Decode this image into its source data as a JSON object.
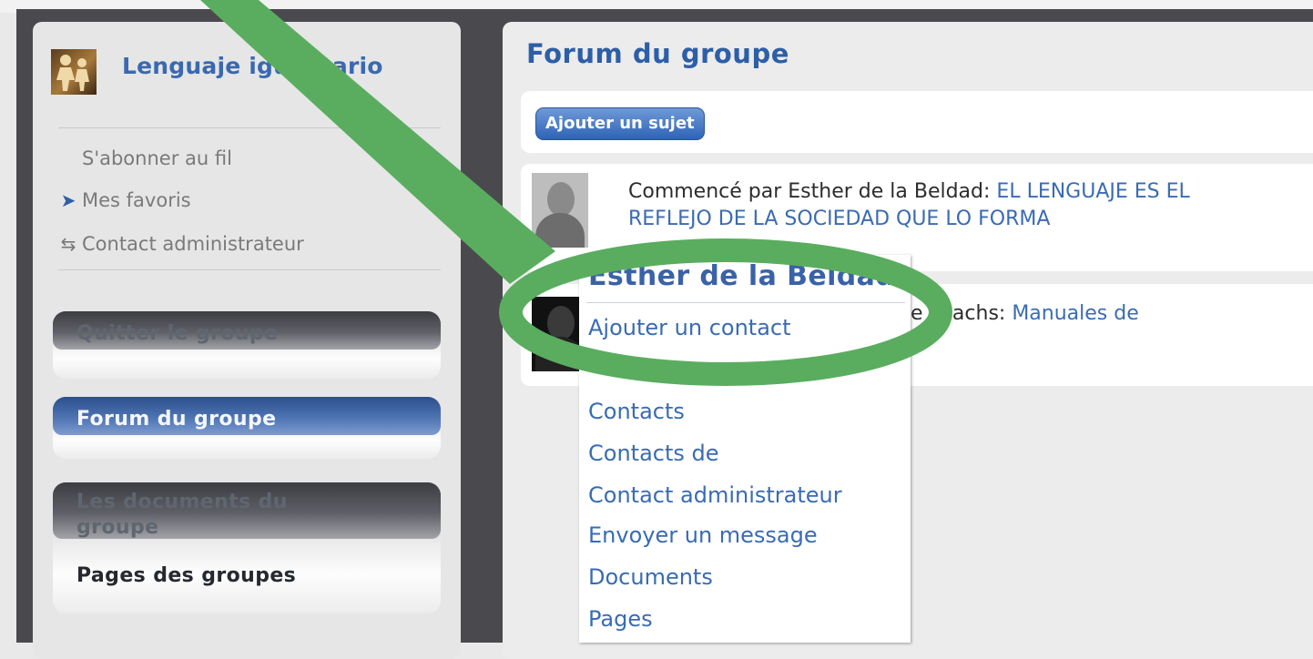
{
  "sidebar": {
    "group_name": "Lenguaje igualitario",
    "links": [
      {
        "label": "S'abonner au fil",
        "icon": "none"
      },
      {
        "label": "Mes favoris",
        "icon": "bookmark-icon"
      },
      {
        "label": "Contact administrateur",
        "icon": "handshake-icon"
      }
    ],
    "buttons": {
      "leave": "Quitter le groupe",
      "forum": "Forum du groupe",
      "documents": "Les documents du groupe",
      "pages": "Pages des groupes"
    }
  },
  "main": {
    "title": "Forum du groupe",
    "add_topic": "Ajouter un sujet",
    "topics": [
      {
        "prefix": "Commencé par Esther de la Beldad: ",
        "link": "EL LENGUAJE ES EL REFLEJO DE LA SOCIEDAD QUE LO FORMA"
      },
      {
        "prefix": "e usachs: ",
        "link": "Manuales de"
      }
    ]
  },
  "popup": {
    "title": "Esther de la Beldad",
    "items": [
      "Ajouter un contact",
      "Contacts",
      "Contacts de",
      "Contact administrateur",
      "Envoyer un message",
      "Documents",
      "Pages"
    ]
  },
  "colors": {
    "link": "#3a6bb3",
    "highlight": "#5aad5f",
    "active_button": "#3f64a4"
  }
}
